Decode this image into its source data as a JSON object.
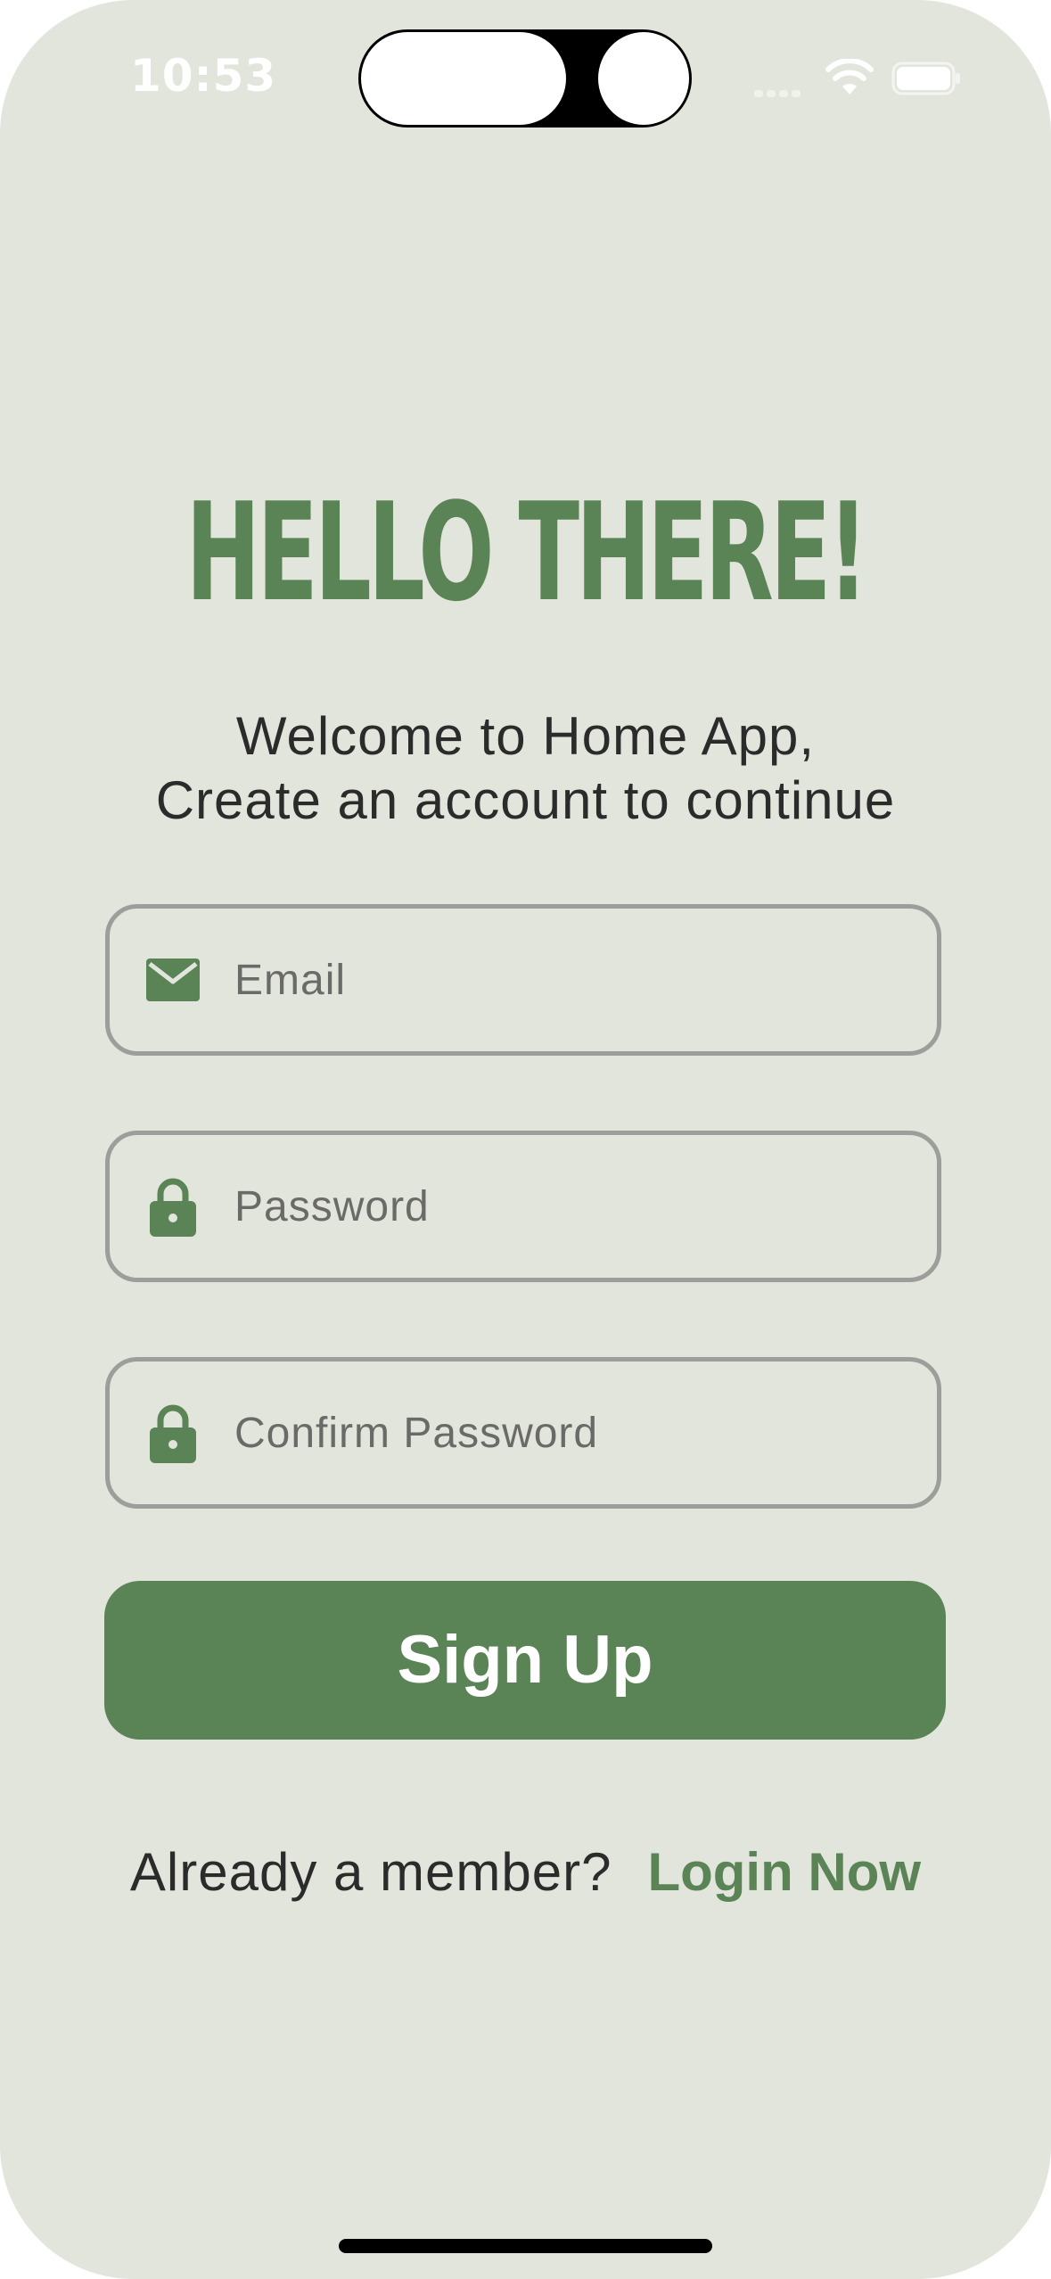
{
  "status_bar": {
    "time": "10:53"
  },
  "header": {
    "title": "HELLO THERE!",
    "subtitle_line1": "Welcome to Home App,",
    "subtitle_line2": "Create an account to continue"
  },
  "form": {
    "email": {
      "placeholder": "Email",
      "value": "",
      "icon": "envelope-icon"
    },
    "password": {
      "placeholder": "Password",
      "value": "",
      "icon": "lock-icon"
    },
    "confirm_password": {
      "placeholder": "Confirm Password",
      "value": "",
      "icon": "lock-icon"
    },
    "submit_label": "Sign Up"
  },
  "footer": {
    "prompt": "Already a member?",
    "login_label": "Login Now"
  },
  "colors": {
    "accent": "#5a8456",
    "background": "#e2e5db",
    "field_border": "#9d9e9b",
    "text": "#2b2b2b"
  }
}
